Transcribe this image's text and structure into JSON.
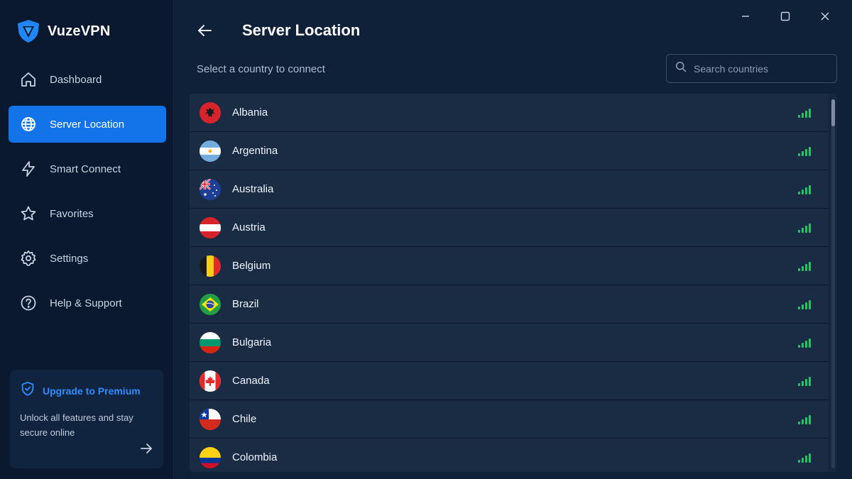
{
  "app": {
    "name": "VuzeVPN"
  },
  "sidebar": {
    "items": [
      {
        "label": "Dashboard",
        "icon": "home-icon",
        "active": false
      },
      {
        "label": "Server Location",
        "icon": "globe-icon",
        "active": true
      },
      {
        "label": "Smart Connect",
        "icon": "lightning-icon",
        "active": false
      },
      {
        "label": "Favorites",
        "icon": "star-icon",
        "active": false
      },
      {
        "label": "Settings",
        "icon": "gear-icon",
        "active": false
      },
      {
        "label": "Help & Support",
        "icon": "help-icon",
        "active": false
      }
    ],
    "promo": {
      "title": "Upgrade to Premium",
      "text": "Unlock all features and stay secure online",
      "icon": "shield-check-icon"
    }
  },
  "main": {
    "title": "Server Location",
    "subtitle": "Select a country to connect",
    "search": {
      "placeholder": "Search countries",
      "value": ""
    },
    "countries": [
      {
        "name": "Albania",
        "flag": "albania"
      },
      {
        "name": "Argentina",
        "flag": "argentina"
      },
      {
        "name": "Australia",
        "flag": "australia"
      },
      {
        "name": "Austria",
        "flag": "austria"
      },
      {
        "name": "Belgium",
        "flag": "belgium"
      },
      {
        "name": "Brazil",
        "flag": "brazil"
      },
      {
        "name": "Bulgaria",
        "flag": "bulgaria"
      },
      {
        "name": "Canada",
        "flag": "canada"
      },
      {
        "name": "Chile",
        "flag": "chile"
      },
      {
        "name": "Colombia",
        "flag": "colombia"
      }
    ]
  },
  "colors": {
    "accent": "#1373e8",
    "signal": "#27c463",
    "promo_title": "#2f8cff",
    "sidebar_bg": "#0a1930",
    "main_bg": "#0f2039"
  }
}
